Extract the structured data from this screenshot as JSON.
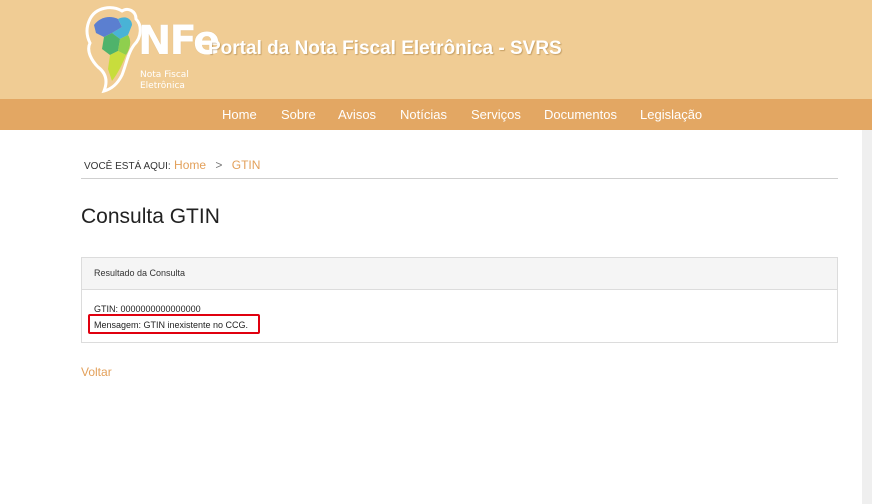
{
  "header": {
    "logo_main": "NFe",
    "logo_sub_line1": "Nota Fiscal",
    "logo_sub_line2": "Eletrônica",
    "site_title": "Portal da Nota Fiscal Eletrônica - SVRS"
  },
  "nav": {
    "items": [
      {
        "label": "Home"
      },
      {
        "label": "Sobre"
      },
      {
        "label": "Avisos"
      },
      {
        "label": "Notícias"
      },
      {
        "label": "Serviços"
      },
      {
        "label": "Documentos"
      },
      {
        "label": "Legislação"
      }
    ]
  },
  "breadcrumb": {
    "prefix": "VOCÊ ESTÁ AQUI:",
    "home": "Home",
    "separator": ">",
    "current": "GTIN"
  },
  "page": {
    "title": "Consulta GTIN"
  },
  "result_panel": {
    "heading": "Resultado da Consulta",
    "gtin_line": "GTIN: 0000000000000000",
    "message_line": "Mensagem: GTIN inexistente no CCG."
  },
  "back_link": "Voltar",
  "colors": {
    "header_bg": "#f0cc94",
    "nav_bg": "#e3a763",
    "link": "#e3a05a",
    "highlight_border": "#e0000f"
  }
}
